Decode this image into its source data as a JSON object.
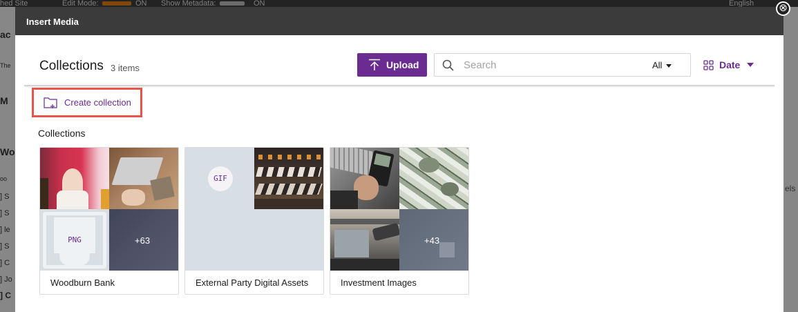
{
  "background": {
    "topbar_items": [
      "hed Site",
      "Edit Mode:",
      "ON",
      "Show Metadata:",
      "ON",
      "English"
    ],
    "left_fragments": [
      "ac",
      "The",
      "M",
      "Wo",
      "oo",
      "] S",
      "] S",
      "] le",
      "] S",
      "] C",
      "] Jo",
      "] C"
    ],
    "right_fragment": "els"
  },
  "close_icon_glyph": "⊗",
  "modal": {
    "title": "Insert Media",
    "header": {
      "title": "Collections",
      "count": "3 items",
      "upload_label": "Upload",
      "search_placeholder": "Search",
      "filter_value": "All",
      "sort_value": "Date"
    },
    "create_collection_label": "Create collection",
    "section_label": "Collections",
    "collections": [
      {
        "name": "Woodburn Bank",
        "more": "+63",
        "badge": "PNG"
      },
      {
        "name": "External Party Digital Assets",
        "badge": "GIF"
      },
      {
        "name": "Investment Images",
        "more": "+43"
      }
    ]
  },
  "colors": {
    "accent": "#6b2c91",
    "highlight": "#e8544a",
    "titlebar": "#3b3b3b"
  }
}
